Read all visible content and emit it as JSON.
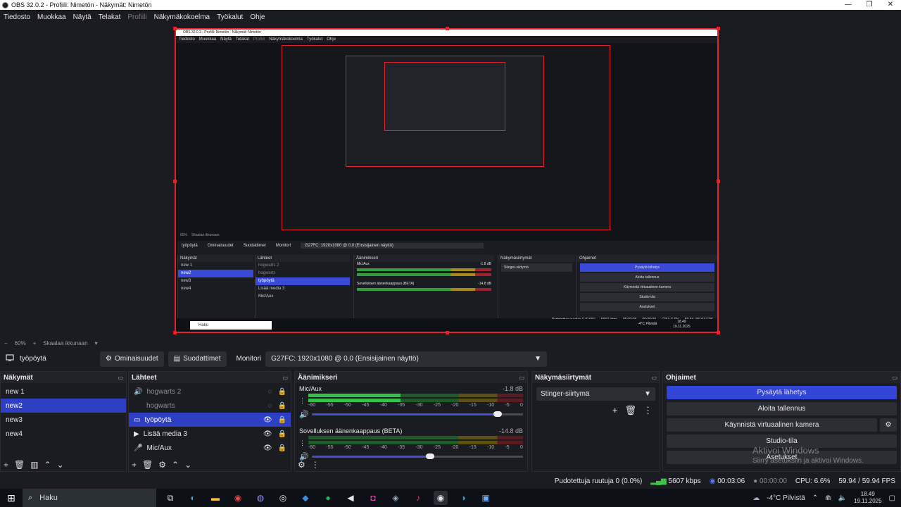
{
  "window": {
    "title": "OBS 32.0.2 - Profiili: Nimetön - Näkymät: Nimetön",
    "controls": [
      "—",
      "❐",
      "✕"
    ]
  },
  "menu": [
    {
      "label": "Tiedosto",
      "disabled": false
    },
    {
      "label": "Muokkaa",
      "disabled": false
    },
    {
      "label": "Näytä",
      "disabled": false
    },
    {
      "label": "Telakat",
      "disabled": false
    },
    {
      "label": "Profiili",
      "disabled": true
    },
    {
      "label": "Näkymäkokoelma",
      "disabled": false
    },
    {
      "label": "Työkalut",
      "disabled": false
    },
    {
      "label": "Ohje",
      "disabled": false
    }
  ],
  "zoombar": {
    "minus": "−",
    "zoom": "60%",
    "plus": "+",
    "scale_label": "Skaalaa ikkunaan",
    "chevron": "▾"
  },
  "propbar": {
    "source_icon": "monitor-icon",
    "source_name": "työpöytä",
    "properties_label": "Ominaisuudet",
    "filters_label": "Suodattimet",
    "monitor_label": "Monitori",
    "monitor_value": "G27FC: 1920x1080 @ 0,0 (Ensisijainen näyttö)"
  },
  "scenes": {
    "title": "Näkymät",
    "items": [
      "new 1",
      "new2",
      "new3",
      "new4"
    ],
    "selected": "new2"
  },
  "sources": {
    "title": "Lähteet",
    "items": [
      {
        "label": "hogwarts 2",
        "icon": "audio-icon",
        "visible": false,
        "locked": true,
        "dim": true
      },
      {
        "label": "hogwarts",
        "icon": "none",
        "visible": false,
        "locked": true,
        "dim": true
      },
      {
        "label": "työpöytä",
        "icon": "monitor-icon",
        "visible": true,
        "locked": true,
        "selected": true
      },
      {
        "label": "Lisää media 3",
        "icon": "play-icon",
        "visible": true,
        "locked": true
      },
      {
        "label": "Mic/Aux",
        "icon": "mic-icon",
        "visible": true,
        "locked": true
      }
    ]
  },
  "mixer": {
    "title": "Äänimikseri",
    "ticks": [
      "-60",
      "-55",
      "-50",
      "-45",
      "-40",
      "-35",
      "-30",
      "-25",
      "-20",
      "-15",
      "-10",
      "-5",
      "0"
    ],
    "channels": [
      {
        "name": "Mic/Aux",
        "db": "-1.8 dB",
        "level": 0.43,
        "volume": 0.88
      },
      {
        "name": "Sovelluksen äänenkaappaus (BETA)",
        "db": "-14.8 dB",
        "level": 0.0,
        "volume": 0.56
      }
    ]
  },
  "transitions": {
    "title": "Näkymäsiirtymät",
    "selected": "Stinger-siirtymä"
  },
  "controls": {
    "title": "Ohjaimet",
    "buttons": [
      "Pysäytä lähetys",
      "Aloita tallennus",
      "Käynnistä virtuaalinen kamera",
      "Studio-tila",
      "Asetukset"
    ]
  },
  "watermark": {
    "line1": "Aktivoi Windows",
    "line2": "Siirry asetuksiin ja aktivoi Windows."
  },
  "status": {
    "dropped": "Pudotettuja ruutuja 0 (0.0%)",
    "bitrate": "5607 kbps",
    "stream_time": "00:03:06",
    "rec_time": "00:00:00",
    "cpu": "CPU: 6.6%",
    "fps": "59.94 / 59.94 FPS"
  },
  "taskbar": {
    "search": "Haku",
    "weather": "-4°C  Pilvistä",
    "time": "18.49",
    "date": "19.11.2025"
  },
  "nested": {
    "title": "OBS 32.0.2 - Profiili: Nimetön - Näkymät: Nimetön",
    "menu": [
      "Tiedosto",
      "Muokkaa",
      "Näytä",
      "Telakat",
      "Profiili",
      "Näkymäkokoelma",
      "Työkalut",
      "Ohje"
    ],
    "zoom": "60%",
    "scale_label": "Skaalaa ikkunaan",
    "source_name": "työpöytä",
    "properties_label": "Ominaisuudet",
    "filters_label": "Suodattimet",
    "monitor_label": "Monitori",
    "monitor_value": "G27FC: 1920x1080 @ 0,0 (Ensisijainen näyttö)",
    "scenes_title": "Näkymät",
    "scenes": [
      "new 1",
      "new2",
      "new3",
      "new4"
    ],
    "sources_title": "Lähteet",
    "sources": [
      "hogwarts 2",
      "hogwarts",
      "työpöytä",
      "Lisää media 3",
      "Mic/Aux"
    ],
    "mixer_title": "Äänimikseri",
    "mixer_ch1": "Mic/Aux",
    "mixer_ch1_db": "-1.8 dB",
    "mixer_ch2": "Sovelluksen äänenkaappaus (BETA)",
    "mixer_ch2_db": "-14.8 dB",
    "transitions_title": "Näkymäsiirtymät",
    "transition": "Stinger-siirtymä",
    "controls_title": "Ohjaimet",
    "controls": [
      "Pysäytä lähetys",
      "Aloita tallennus",
      "Käynnistä virtuaalinen kamera",
      "Studio-tila",
      "Asetukset"
    ],
    "search": "Haku",
    "status": "Pudotettuja ruutuja 0 (0.0%)",
    "bitrate": "5607 kbps",
    "stream_time": "00:03:06",
    "rec_time": "00:00:00",
    "cpu": "CPU: 6.6%",
    "fps": "59.94 / 59.94 FPS",
    "weather": "-4°C  Pilvistä",
    "time": "18.49",
    "date": "19.11.2025"
  },
  "colors": {
    "accent": "#2f3fc4",
    "border_red": "#e0242b",
    "bg": "#1b1c22"
  }
}
